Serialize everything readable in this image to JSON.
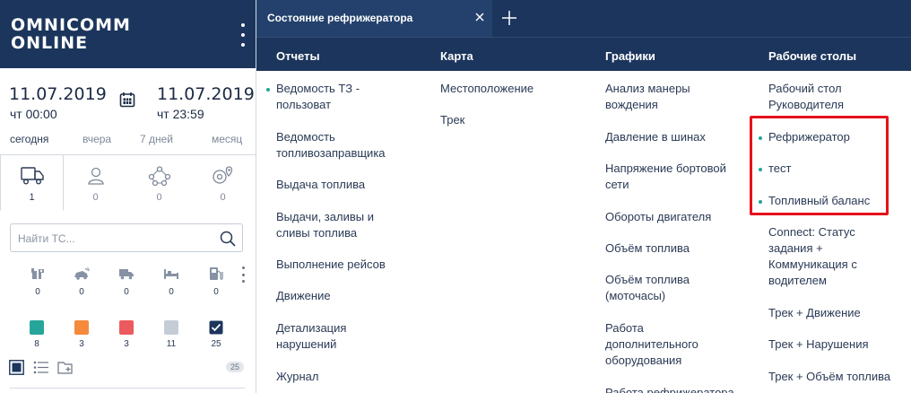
{
  "sidebar": {
    "logo_line1": "OMNICOMM",
    "logo_line2": "ONLINE",
    "date_from": "11.07.2019",
    "time_from": "чт 00:00",
    "date_to": "11.07.2019",
    "time_to": "чт 23:59",
    "periods": [
      "сегодня",
      "вчера",
      "7 дней",
      "месяц"
    ],
    "object_tabs": [
      {
        "icon": "truck-icon",
        "count": "1"
      },
      {
        "icon": "user-icon",
        "count": "0"
      },
      {
        "icon": "network-icon",
        "count": "0"
      },
      {
        "icon": "geozone-icon",
        "count": "0"
      }
    ],
    "search_placeholder": "Найти ТС...",
    "status_icons": [
      {
        "icon": "repair-icon",
        "count": "0"
      },
      {
        "icon": "car-crash-icon",
        "count": "0"
      },
      {
        "icon": "moving-truck-icon",
        "count": "0"
      },
      {
        "icon": "parked-icon",
        "count": "0"
      },
      {
        "icon": "fuel-icon",
        "count": "0"
      }
    ],
    "color_filters": [
      {
        "color": "#26a69a",
        "count": "8"
      },
      {
        "color": "#f58a3c",
        "count": "3"
      },
      {
        "color": "#ec5a5f",
        "count": "3"
      },
      {
        "color": "#c5ccd6",
        "count": "11"
      },
      {
        "color": "#1b355c",
        "count": "25",
        "checked": true
      }
    ],
    "total_count": "25"
  },
  "tabs": {
    "active_title": "Состояние рефрижератора"
  },
  "menu": {
    "headers": [
      "Отчеты",
      "Карта",
      "Графики",
      "Рабочие столы"
    ],
    "reports": [
      "Ведомость ТЗ -\nпользоват",
      "Ведомость\nтопливозаправщика",
      "Выдача топлива",
      "Выдачи, заливы и\nсливы топлива",
      "Выполнение рейсов",
      "Движение",
      "Детализация\nнарушений",
      "Журнал"
    ],
    "map": [
      "Местоположение",
      "Трек"
    ],
    "charts": [
      "Анализ манеры\nвождения",
      "Давление в шинах",
      "Напряжение бортовой\nсети",
      "Обороты двигателя",
      "Объём топлива",
      "Объём топлива\n(моточасы)",
      "Работа\nдополнительного\nоборудования",
      "Работа рефрижератора"
    ],
    "dashboards": [
      "Рабочий стол\nРуководителя",
      "Рефрижератор",
      "тест",
      "Топливный баланс",
      "Connect: Статус\nзадания +\nКоммуникация с\nводителем",
      "Трек + Движение",
      "Трек + Нарушения",
      "Трек + Объём топлива"
    ]
  },
  "colors": {
    "brand_navy": "#1b355c",
    "accent_teal": "#23a39b",
    "highlight_red": "#e5121b"
  }
}
